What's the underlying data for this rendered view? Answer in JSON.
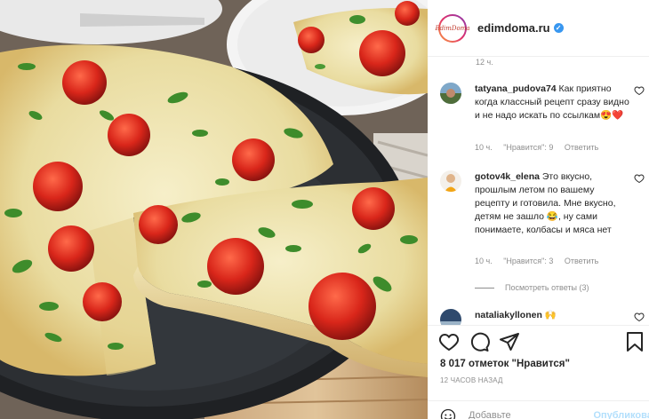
{
  "photo": {
    "alt_subject": "zucchini frittata with cherry tomatoes in a black pan"
  },
  "header": {
    "username": "edimdoma.ru",
    "verified": true,
    "logo_text": "EdimDoma"
  },
  "time_top": "12 ч.",
  "comments": [
    {
      "username": "tatyana_pudova74",
      "text": "Как приятно когда классный рецепт сразу видно и не надо искать по ссылкам😍❤️",
      "time": "10 ч.",
      "likes": "\"Нравится\": 9",
      "reply": "Ответить"
    },
    {
      "username": "gotov4k_elena",
      "text": "Это вкусно, прошлым летом по вашему рецепту и готовила. Мне вкусно, детям не зашло 😂, ну сами понимаете, колбасы и мяса нет",
      "time": "10 ч.",
      "likes": "\"Нравится\": 3",
      "reply": "Ответить"
    },
    {
      "username": "nataliakyllonen",
      "text": "🙌",
      "time": "",
      "likes": "",
      "reply": ""
    }
  ],
  "more_replies": "Посмотреть ответы (3)",
  "icons": {
    "like": "heart-icon",
    "comment": "comment-icon",
    "share": "share-icon",
    "save": "bookmark-icon",
    "emoji": "smiley-icon"
  },
  "likes_text": "8 017 отметок \"Нравится\"",
  "post_date": "12 ЧАСОВ НАЗАД",
  "add_comment": {
    "placeholder": "Добавьте",
    "publish_label": "Опубликовать"
  },
  "colors": {
    "link_blue": "#3897f0",
    "muted": "#8e8e8e",
    "publish_disabled": "#b2dffc",
    "heart_red": "#ed4956"
  }
}
